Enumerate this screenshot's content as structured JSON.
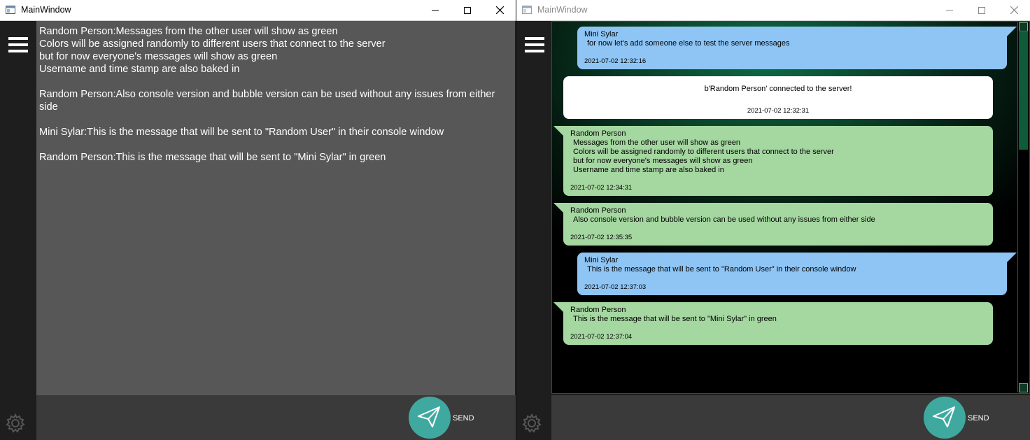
{
  "left_window": {
    "title": "MainWindow",
    "messages": [
      "Random Person:Messages from the other user will show as green\nColors will be assigned randomly to different users that connect to the server\nbut for now everyone's messages will show as green\nUsername and time stamp are also baked in",
      "Random Person:Also console version and bubble version can be used without any issues from either side",
      "Mini Sylar:This is the message that will be sent to \"Random User\" in their console window",
      "Random Person:This is the message that will be sent to \"Mini Sylar\" in green"
    ],
    "send_label": "SEND"
  },
  "right_window": {
    "title": "MainWindow",
    "bubbles": [
      {
        "type": "blue",
        "sender": "Mini Sylar",
        "text": "for now let's add someone else to test the server messages",
        "time": "2021-07-02 12:32:16"
      },
      {
        "type": "white",
        "sender": "",
        "text": "b'Random Person' connected to the server!",
        "time": "2021-07-02 12:32:31"
      },
      {
        "type": "green",
        "sender": "Random Person",
        "text": "Messages from the other user will show as green\nColors will be assigned randomly to different users that connect to the server\nbut for now everyone's messages will show as green\nUsername and time stamp are also baked in",
        "time": "2021-07-02 12:34:31"
      },
      {
        "type": "green",
        "sender": "Random Person",
        "text": "Also console version and bubble version can be used without any issues from either side",
        "time": "2021-07-02 12:35:35"
      },
      {
        "type": "blue",
        "sender": "Mini Sylar",
        "text": "This is the message that will be sent to \"Random User\" in their console window",
        "time": "2021-07-02 12:37:03"
      },
      {
        "type": "green",
        "sender": "Random Person",
        "text": "This is the message that will be sent to \"Mini Sylar\" in green",
        "time": "2021-07-02 12:37:04"
      }
    ],
    "send_label": "SEND"
  },
  "colors": {
    "console_bg": "#575757",
    "bubble_blue": "#8ec5f5",
    "bubble_green": "#a5d7a1",
    "send_button": "#3fa9a0"
  },
  "icons": {
    "app": "app-window-icon",
    "menu": "hamburger-menu-icon",
    "settings": "gear-icon",
    "send": "paper-plane-icon",
    "minimize": "minimize-icon",
    "maximize": "maximize-icon",
    "close": "close-icon"
  }
}
